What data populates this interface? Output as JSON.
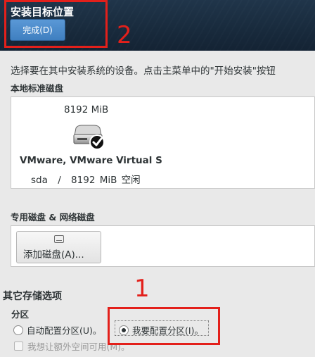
{
  "header": {
    "title": "安装目标位置",
    "done_button": "完成(D)"
  },
  "intro_text": "选择要在其中安装系统的设备。点击主菜单中的\"开始安装\"按钮",
  "local_disks": {
    "section_label": "本地标准磁盘",
    "disk": {
      "size": "8192 MiB",
      "name": "VMware, VMware Virtual S",
      "device": "sda",
      "separator": "/",
      "free": "8192 MiB 空闲",
      "selected": true
    }
  },
  "special_disks": {
    "section_label": "专用磁盘 & 网络磁盘",
    "add_button": "添加磁盘(A)..."
  },
  "other_options": {
    "title": "其它存储选项",
    "partitioning_label": "分区",
    "auto_option": "自动配置分区(U)。",
    "manual_option": "我要配置分区(I)。",
    "selected_option": "manual",
    "extra_space_option": "我想让额外空间可用(M)。"
  },
  "annotations": {
    "label_1": "1",
    "label_2": "2",
    "color": "#e3201b"
  }
}
